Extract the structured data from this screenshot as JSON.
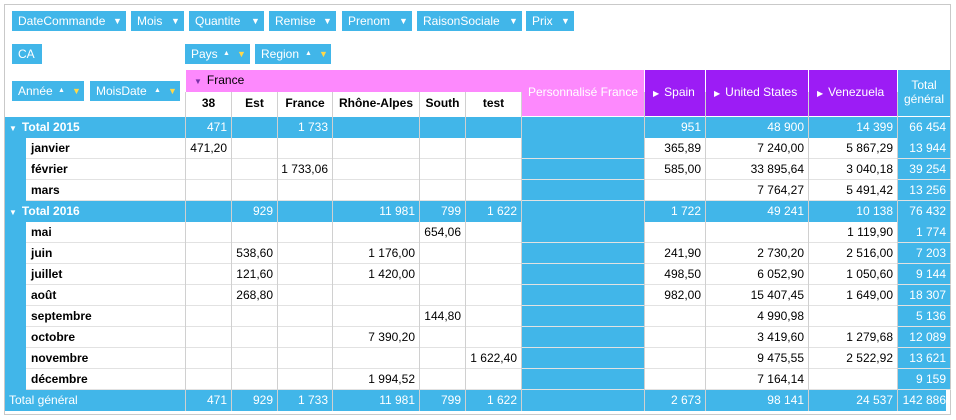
{
  "filter_fields": [
    {
      "name": "DateCommande"
    },
    {
      "name": "Mois"
    },
    {
      "name": "Quantite"
    },
    {
      "name": "Remise"
    },
    {
      "name": "Prenom"
    },
    {
      "name": "RaisonSociale"
    },
    {
      "name": "Prix"
    }
  ],
  "data_field": "CA",
  "column_fields": [
    "Pays",
    "Region"
  ],
  "row_fields": [
    "Année",
    "MoisDate"
  ],
  "france_group": "France",
  "france_regions": [
    "38",
    "Est",
    "France",
    "Rhône-Alpes",
    "South",
    "test"
  ],
  "custom_column": "Personnalisé France",
  "countries": [
    "Spain",
    "United States",
    "Venezuela"
  ],
  "grand_total_header": [
    "Total",
    "général"
  ],
  "years": [
    {
      "label": "Total 2015",
      "total": [
        "471",
        "",
        "1 733",
        "",
        "",
        "",
        "",
        "951",
        "48 900",
        "14 399",
        "66 454"
      ],
      "months": [
        {
          "label": "janvier",
          "values": [
            "471,20",
            "",
            "",
            "",
            "",
            "",
            "",
            "365,89",
            "7 240,00",
            "5 867,29",
            "13 944"
          ]
        },
        {
          "label": "février",
          "values": [
            "",
            "",
            "1 733,06",
            "",
            "",
            "",
            "",
            "585,00",
            "33 895,64",
            "3 040,18",
            "39 254"
          ]
        },
        {
          "label": "mars",
          "values": [
            "",
            "",
            "",
            "",
            "",
            "",
            "",
            "",
            "7 764,27",
            "5 491,42",
            "13 256"
          ]
        }
      ]
    },
    {
      "label": "Total 2016",
      "total": [
        "",
        "929",
        "",
        "11 981",
        "799",
        "1 622",
        "",
        "1 722",
        "49 241",
        "10 138",
        "76 432"
      ],
      "months": [
        {
          "label": "mai",
          "values": [
            "",
            "",
            "",
            "",
            "654,06",
            "",
            "",
            "",
            "",
            "1 119,90",
            "1 774"
          ]
        },
        {
          "label": "juin",
          "values": [
            "",
            "538,60",
            "",
            "1 176,00",
            "",
            "",
            "",
            "241,90",
            "2 730,20",
            "2 516,00",
            "7 203"
          ]
        },
        {
          "label": "juillet",
          "values": [
            "",
            "121,60",
            "",
            "1 420,00",
            "",
            "",
            "",
            "498,50",
            "6 052,90",
            "1 050,60",
            "9 144"
          ]
        },
        {
          "label": "août",
          "values": [
            "",
            "268,80",
            "",
            "",
            "",
            "",
            "",
            "982,00",
            "15 407,45",
            "1 649,00",
            "18 307"
          ]
        },
        {
          "label": "septembre",
          "values": [
            "",
            "",
            "",
            "",
            "144,80",
            "",
            "",
            "",
            "4 990,98",
            "",
            "5 136"
          ]
        },
        {
          "label": "octobre",
          "values": [
            "",
            "",
            "",
            "7 390,20",
            "",
            "",
            "",
            "",
            "3 419,60",
            "1 279,68",
            "12 089"
          ]
        },
        {
          "label": "novembre",
          "values": [
            "",
            "",
            "",
            "",
            "",
            "1 622,40",
            "",
            "",
            "9 475,55",
            "2 522,92",
            "13 621"
          ]
        },
        {
          "label": "décembre",
          "values": [
            "",
            "",
            "",
            "1 994,52",
            "",
            "",
            "",
            "",
            "7 164,14",
            "",
            "9 159"
          ]
        }
      ]
    }
  ],
  "grand_total": {
    "label": "Total général",
    "values": [
      "471",
      "929",
      "1 733",
      "11 981",
      "799",
      "1 622",
      "",
      "2 673",
      "98 141",
      "24 537",
      "142 886"
    ]
  }
}
